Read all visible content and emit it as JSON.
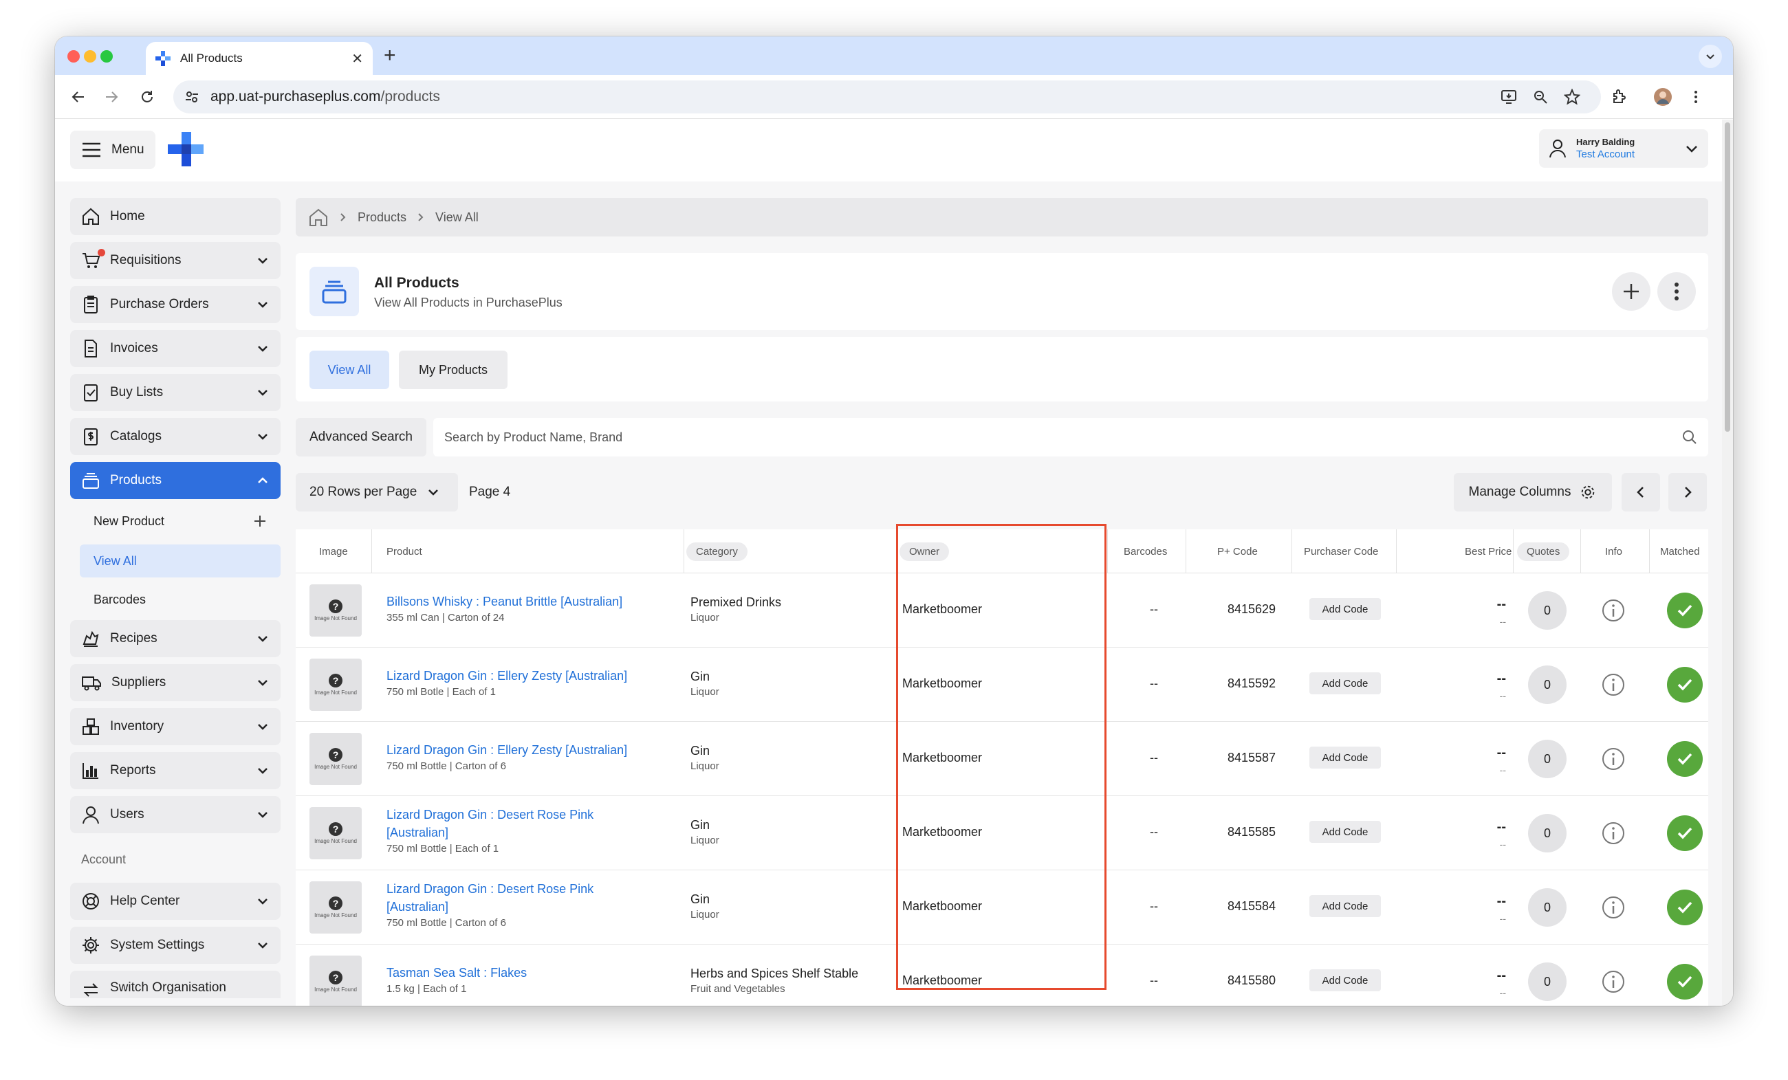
{
  "browser": {
    "tab_title": "All Products",
    "new_tab_symbol": "+",
    "url_host": "app.uat-purchaseplus.com",
    "url_path": "/products"
  },
  "header": {
    "menu_label": "Menu",
    "user_name": "Harry Balding",
    "account_name": "Test Account"
  },
  "sidebar": {
    "items": [
      {
        "label": "Home",
        "icon": "home-icon"
      },
      {
        "label": "Requisitions",
        "icon": "cart-icon"
      },
      {
        "label": "Purchase Orders",
        "icon": "clipboard-icon"
      },
      {
        "label": "Invoices",
        "icon": "document-icon"
      },
      {
        "label": "Buy Lists",
        "icon": "checklist-icon"
      },
      {
        "label": "Catalogs",
        "icon": "dollar-document-icon"
      },
      {
        "label": "Products",
        "icon": "products-icon"
      },
      {
        "label": "Recipes",
        "icon": "chef-icon"
      },
      {
        "label": "Suppliers",
        "icon": "truck-icon"
      },
      {
        "label": "Inventory",
        "icon": "boxes-icon"
      },
      {
        "label": "Reports",
        "icon": "bar-chart-icon"
      },
      {
        "label": "Users",
        "icon": "user-icon"
      }
    ],
    "products_sub": {
      "new_product": "New Product",
      "view_all": "View All",
      "barcodes": "Barcodes"
    },
    "account_heading": "Account",
    "account_items": [
      {
        "label": "Help Center",
        "icon": "lifebuoy-icon"
      },
      {
        "label": "System Settings",
        "icon": "gear-icon"
      },
      {
        "label": "Switch Organisation",
        "icon": "switch-icon"
      }
    ]
  },
  "breadcrumb": {
    "items": [
      "Products",
      "View All"
    ]
  },
  "page_header": {
    "title": "All Products",
    "subtitle": "View All Products in PurchasePlus"
  },
  "tabs": {
    "view_all": "View All",
    "my_products": "My Products"
  },
  "search": {
    "advanced_label": "Advanced Search",
    "placeholder": "Search by Product Name, Brand"
  },
  "pagination": {
    "rows_per_page": "20 Rows per Page",
    "page_label": "Page 4",
    "manage_columns": "Manage Columns"
  },
  "table": {
    "columns": {
      "image": "Image",
      "product": "Product",
      "category": "Category",
      "owner": "Owner",
      "barcodes": "Barcodes",
      "pcode": "P+ Code",
      "purchaser_code": "Purchaser Code",
      "best_price": "Best Price",
      "quotes": "Quotes",
      "info": "Info",
      "matched": "Matched"
    },
    "image_placeholder": "Image Not Found",
    "add_code_label": "Add Code",
    "rows": [
      {
        "name": "Billsons Whisky : Peanut Brittle [Australian]",
        "desc": "355 ml Can | Carton of 24",
        "category": "Premixed Drinks",
        "subcategory": "Liquor",
        "owner": "Marketboomer",
        "barcodes": "--",
        "pcode": "8415629",
        "price": "--",
        "price_sub": "--",
        "quotes": "0"
      },
      {
        "name": "Lizard Dragon Gin : Ellery Zesty [Australian]",
        "desc": "750 ml Botle | Each of 1",
        "category": "Gin",
        "subcategory": "Liquor",
        "owner": "Marketboomer",
        "barcodes": "--",
        "pcode": "8415592",
        "price": "--",
        "price_sub": "--",
        "quotes": "0"
      },
      {
        "name": "Lizard Dragon Gin : Ellery Zesty [Australian]",
        "desc": "750 ml Bottle | Carton of 6",
        "category": "Gin",
        "subcategory": "Liquor",
        "owner": "Marketboomer",
        "barcodes": "--",
        "pcode": "8415587",
        "price": "--",
        "price_sub": "--",
        "quotes": "0"
      },
      {
        "name": "Lizard Dragon Gin : Desert Rose Pink [Australian]",
        "desc": "750 ml Bottle | Each of 1",
        "category": "Gin",
        "subcategory": "Liquor",
        "owner": "Marketboomer",
        "barcodes": "--",
        "pcode": "8415585",
        "price": "--",
        "price_sub": "--",
        "quotes": "0"
      },
      {
        "name": "Lizard Dragon Gin : Desert Rose Pink [Australian]",
        "desc": "750 ml Bottle | Carton of 6",
        "category": "Gin",
        "subcategory": "Liquor",
        "owner": "Marketboomer",
        "barcodes": "--",
        "pcode": "8415584",
        "price": "--",
        "price_sub": "--",
        "quotes": "0"
      },
      {
        "name": "Tasman Sea Salt : Flakes",
        "desc": "1.5 kg | Each of 1",
        "category": "Herbs and Spices Shelf Stable",
        "subcategory": "Fruit and Vegetables",
        "owner": "Marketboomer",
        "barcodes": "--",
        "pcode": "8415580",
        "price": "--",
        "price_sub": "--",
        "quotes": "0"
      }
    ]
  },
  "colors": {
    "accent": "#2f6fde",
    "highlight": "#e64a2e",
    "matched": "#58a83c",
    "link": "#1f6fd8"
  }
}
